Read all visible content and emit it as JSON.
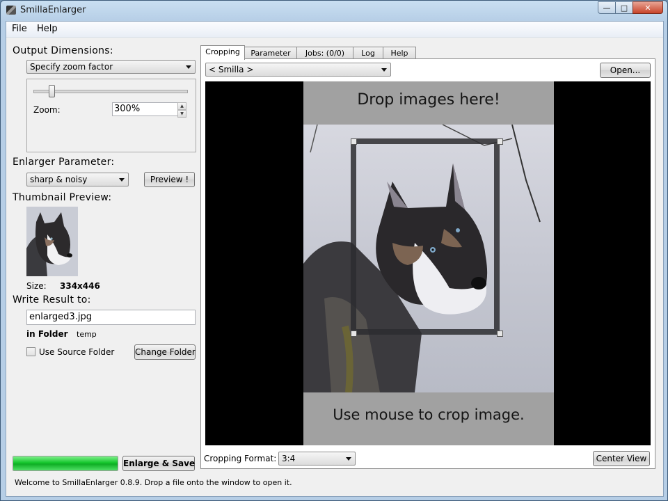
{
  "window": {
    "title": "SmillaEnlarger"
  },
  "menu": {
    "file": "File",
    "help": "Help"
  },
  "left": {
    "output_dimensions_title": "Output Dimensions:",
    "dimension_mode": "Specify zoom factor",
    "zoom_label": "Zoom:",
    "zoom_value": "300%",
    "zoom_slider_level_percent": 12,
    "enlarger_param_title": "Enlarger Parameter:",
    "preset": "sharp & noisy",
    "preview_button": "Preview !",
    "thumbnail_title": "Thumbnail Preview:",
    "size_label": "Size:",
    "size_value": "334x446",
    "write_result_title": "Write Result to:",
    "filename": "enlarged3.jpg",
    "in_folder_label": "in Folder",
    "folder_value": "temp",
    "use_source_folder_label": "Use Source Folder",
    "use_source_folder_checked": false,
    "change_folder_button": "Change Folder",
    "enlarge_save_button": "Enlarge & Save",
    "progress_percent": 100
  },
  "status_text": "Welcome to SmillaEnlarger 0.8.9.  Drop a file onto the window to open it.",
  "right": {
    "tabs": [
      {
        "label": "Cropping",
        "active": true
      },
      {
        "label": "Parameter",
        "active": false
      },
      {
        "label": "Jobs: (0/0)",
        "active": false
      },
      {
        "label": "Log",
        "active": false
      },
      {
        "label": "Help",
        "active": false
      }
    ],
    "source_select": "< Smilla >",
    "open_button": "Open...",
    "drop_text": "Drop images here!",
    "crop_text": "Use mouse to crop image.",
    "cropping_format_label": "Cropping Format:",
    "cropping_format_value": "3:4",
    "center_view_button": "Center View"
  },
  "colors": {
    "progress": "#14c62c",
    "canvas_bg": "#000000",
    "image_area_bg": "#a1a1a1",
    "close_button": "#c8442a"
  }
}
